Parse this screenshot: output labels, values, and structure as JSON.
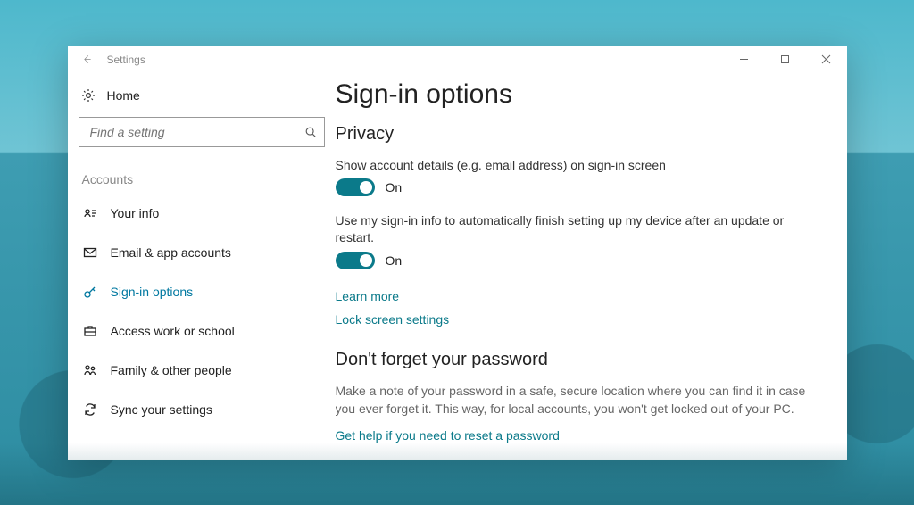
{
  "titlebar": {
    "back_label": "Back",
    "app_title": "Settings"
  },
  "sidebar": {
    "home_label": "Home",
    "search_placeholder": "Find a setting",
    "section_label": "Accounts",
    "items": [
      {
        "icon": "person-card-icon",
        "label": "Your info"
      },
      {
        "icon": "mail-icon",
        "label": "Email & app accounts"
      },
      {
        "icon": "key-icon",
        "label": "Sign-in options"
      },
      {
        "icon": "briefcase-icon",
        "label": "Access work or school"
      },
      {
        "icon": "family-icon",
        "label": "Family & other people"
      },
      {
        "icon": "sync-icon",
        "label": "Sync your settings"
      }
    ],
    "active_index": 2
  },
  "content": {
    "page_title": "Sign-in options",
    "privacy": {
      "heading": "Privacy",
      "show_account": {
        "label": "Show account details (e.g. email address) on sign-in screen",
        "state": "On"
      },
      "auto_finish": {
        "label": "Use my sign-in info to automatically finish setting up my device after an update or restart.",
        "state": "On"
      },
      "learn_more": "Learn more",
      "lock_screen": "Lock screen settings"
    },
    "forget": {
      "heading": "Don't forget your password",
      "body": "Make a note of your password in a safe, secure location where you can find it in case you ever forget it. This way, for local accounts, you won't get locked out of your PC.",
      "help_link": "Get help if you need to reset a password"
    }
  },
  "colors": {
    "accent": "#0b7a8a",
    "link": "#0b7a8a"
  }
}
